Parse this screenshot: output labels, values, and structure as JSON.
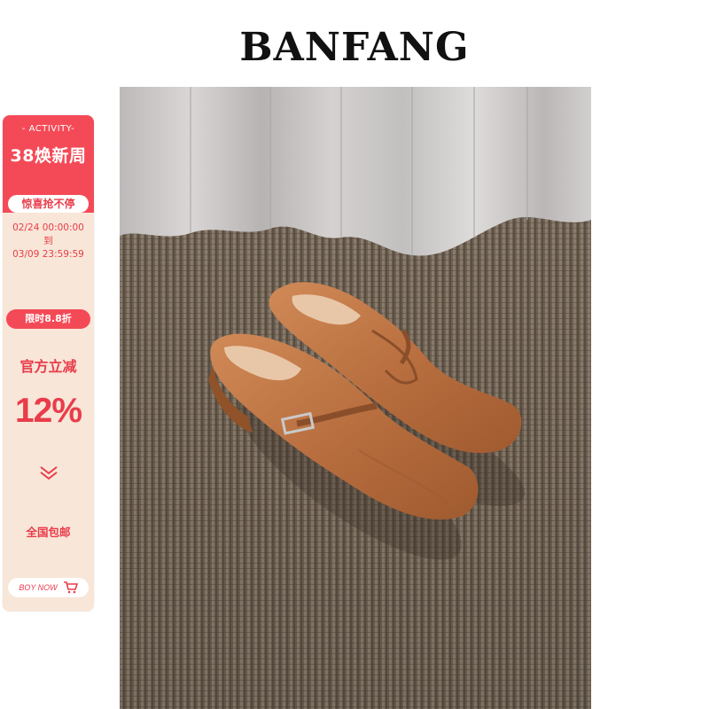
{
  "brand": {
    "title": "BANFANG"
  },
  "promo": {
    "activity_label": "- ACTIVITY-",
    "event_title": "38焕新周",
    "surprise_label": "惊喜抢不停",
    "date_start": "02/24 00:00:00",
    "date_to": "到",
    "date_end": "03/09 23:59:59",
    "discount_label": "限时8.8折",
    "official_label": "官方立减",
    "percent_value": "12%",
    "shipping_label": "全国包邮",
    "buy_label": "BOY NOW",
    "chevron_icon": "double-chevron-down-icon",
    "cart_icon": "shopping-cart-icon"
  },
  "colors": {
    "accent_red": "#f44a57",
    "promo_bg": "#f8e6d8",
    "text_red": "#e93c4a",
    "leather": "#c0784a",
    "carpet": "#6f6254",
    "curtain": "#cfcdcd"
  }
}
